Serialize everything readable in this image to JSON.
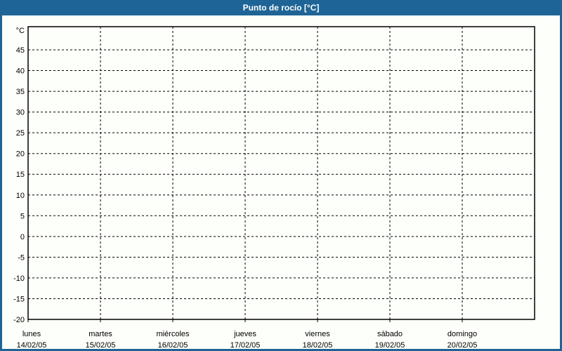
{
  "window": {
    "title": "Punto de rocío [°C]"
  },
  "colors": {
    "titlebar": "#1e6496",
    "window_border": "#1e6496",
    "background": "#fdfffa",
    "grid": "#000000",
    "axis": "#000000",
    "text": "#000000",
    "title_text": "#ffffff"
  },
  "chart_data": {
    "type": "line",
    "title": "Punto de rocío [°C]",
    "ylabel": "°C",
    "unit_label": "°C",
    "ylim": [
      -20,
      50
    ],
    "y_ticks": [
      45,
      40,
      35,
      30,
      25,
      20,
      15,
      10,
      5,
      0,
      -5,
      -10,
      -15,
      -20
    ],
    "x_days": [
      {
        "label": "lunes",
        "date": "14/02/05"
      },
      {
        "label": "martes",
        "date": "15/02/05"
      },
      {
        "label": "miércoles",
        "date": "16/02/05"
      },
      {
        "label": "jueves",
        "date": "17/02/05"
      },
      {
        "label": "viernes",
        "date": "18/02/05"
      },
      {
        "label": "sábado",
        "date": "19/02/05"
      },
      {
        "label": "domingo",
        "date": "20/02/05"
      }
    ],
    "series": [],
    "grid": "dashed",
    "legend": "none"
  }
}
